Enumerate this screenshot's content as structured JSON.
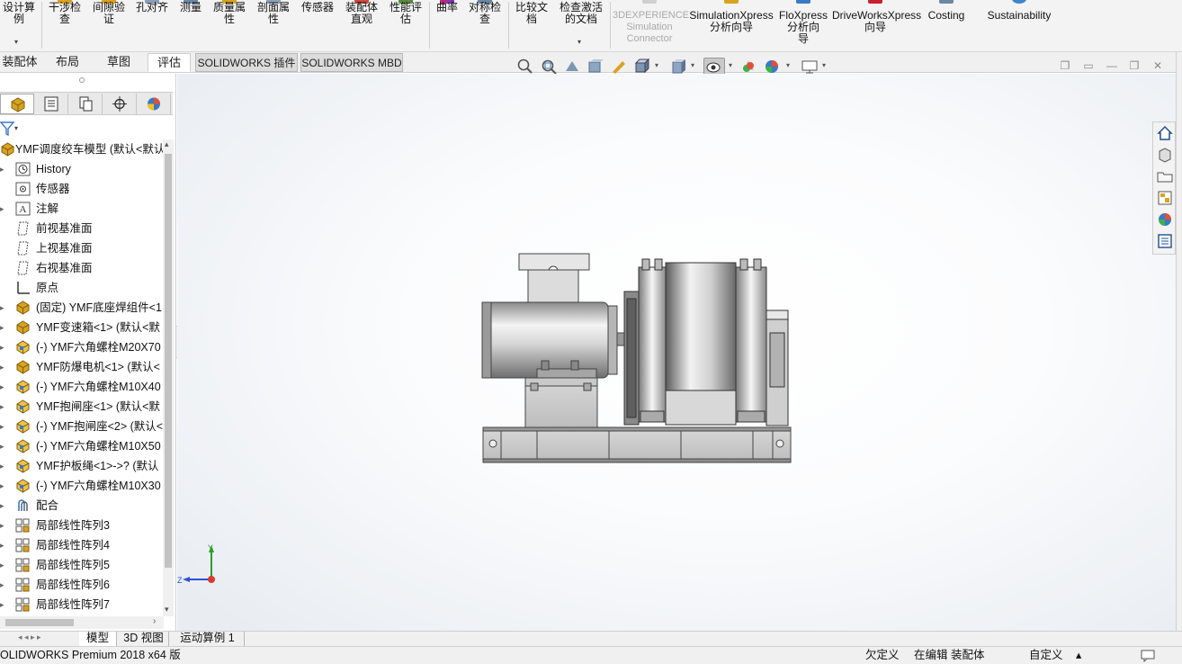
{
  "ribbon": {
    "buttons": [
      {
        "label": "设计算\n例",
        "icon": "design-study-icon"
      },
      {
        "label": "干涉检\n查",
        "icon": "interference-check-icon"
      },
      {
        "label": "间隙验\n证",
        "icon": "clearance-verification-icon"
      },
      {
        "label": "孔对齐",
        "icon": "hole-alignment-icon"
      },
      {
        "label": "测量",
        "icon": "measure-icon"
      },
      {
        "label": "质量属\n性",
        "icon": "mass-properties-icon"
      },
      {
        "label": "剖面属\n性",
        "icon": "section-properties-icon"
      },
      {
        "label": "传感器",
        "icon": "sensor-icon"
      },
      {
        "label": "装配体\n直观",
        "icon": "assembly-visualization-icon"
      },
      {
        "label": "性能评\n估",
        "icon": "performance-evaluation-icon"
      },
      {
        "label": "曲率",
        "icon": "curvature-icon"
      },
      {
        "label": "对称检\n查",
        "icon": "symmetry-check-icon"
      },
      {
        "label": "比较文\n档",
        "icon": "compare-documents-icon"
      },
      {
        "label": "检查激活\n的文档",
        "icon": "check-active-document-icon"
      },
      {
        "label": "3DEXPERIENCE\nSimulation\nConnector",
        "icon": "3dexperience-icon"
      },
      {
        "label": "SimulationXpress\n分析向导",
        "icon": "simulationxpress-icon"
      },
      {
        "label": "FloXpress\n分析向\n导",
        "icon": "floxpress-icon"
      },
      {
        "label": "DriveWorksXpress\n向导",
        "icon": "driveworksxpress-icon"
      },
      {
        "label": "Costing",
        "icon": "costing-icon"
      },
      {
        "label": "Sustainability",
        "icon": "sustainability-icon"
      }
    ]
  },
  "tabs": [
    "装配体",
    "布局",
    "草图",
    "评估",
    "SOLIDWORKS 插件",
    "SOLIDWORKS MBD"
  ],
  "window": {
    "restore": "❐",
    "maximize": "▭",
    "minimize": "—",
    "restore2": "❐",
    "close": "✕"
  },
  "tree": {
    "root": "YMF调度绞车模型  (默认<默认",
    "items": [
      {
        "label": "History",
        "icon": "history-icon",
        "exp": "▸"
      },
      {
        "label": "传感器",
        "icon": "sensor-folder-icon",
        "exp": ""
      },
      {
        "label": "注解",
        "icon": "annotations-icon",
        "exp": "▸"
      },
      {
        "label": "前视基准面",
        "icon": "plane-icon",
        "exp": ""
      },
      {
        "label": "上视基准面",
        "icon": "plane-icon",
        "exp": ""
      },
      {
        "label": "右视基准面",
        "icon": "plane-icon",
        "exp": ""
      },
      {
        "label": "原点",
        "icon": "origin-icon",
        "exp": ""
      },
      {
        "label": "(固定) YMF底座焊组件<1",
        "icon": "subassembly-icon",
        "exp": "▸"
      },
      {
        "label": "YMF变速箱<1> (默认<默",
        "icon": "subassembly-icon",
        "exp": "▸"
      },
      {
        "label": "(-) YMF六角螺栓M20X70",
        "icon": "part-icon",
        "exp": "▸"
      },
      {
        "label": "YMF防爆电机<1> (默认<",
        "icon": "subassembly-icon",
        "exp": "▸"
      },
      {
        "label": "(-) YMF六角螺栓M10X40",
        "icon": "part-icon",
        "exp": "▸"
      },
      {
        "label": "YMF抱闸座<1> (默认<默",
        "icon": "part-icon",
        "exp": "▸"
      },
      {
        "label": "(-) YMF抱闸座<2> (默认<",
        "icon": "part-icon",
        "exp": "▸"
      },
      {
        "label": "(-) YMF六角螺栓M10X50",
        "icon": "part-icon",
        "exp": "▸"
      },
      {
        "label": "YMF护板绳<1>->? (默认",
        "icon": "part-icon",
        "exp": "▸"
      },
      {
        "label": "(-) YMF六角螺栓M10X30",
        "icon": "part-icon",
        "exp": "▸"
      },
      {
        "label": "配合",
        "icon": "mates-icon",
        "exp": "▸"
      },
      {
        "label": "局部线性阵列3",
        "icon": "linear-pattern-icon",
        "exp": "▸"
      },
      {
        "label": "局部线性阵列4",
        "icon": "linear-pattern-icon",
        "exp": "▸"
      },
      {
        "label": "局部线性阵列5",
        "icon": "linear-pattern-icon",
        "exp": "▸"
      },
      {
        "label": "局部线性阵列6",
        "icon": "linear-pattern-icon",
        "exp": "▸"
      },
      {
        "label": "局部线性阵列7",
        "icon": "linear-pattern-icon",
        "exp": "▸"
      }
    ]
  },
  "bottom_tabs": [
    "模型",
    "3D 视图",
    "运动算例 1"
  ],
  "status": {
    "product": "OLIDWORKS Premium 2018 x64 版",
    "underdefined": "欠定义",
    "editing": "在编辑 装配体",
    "custom": "自定义",
    "caret": "▴"
  },
  "triad": {
    "y": "Y",
    "z": "Z"
  },
  "colors": {
    "ribbon_bg": "#f3f3f3",
    "panel_bg": "#ffffff",
    "accent": "#1f6fb2"
  }
}
